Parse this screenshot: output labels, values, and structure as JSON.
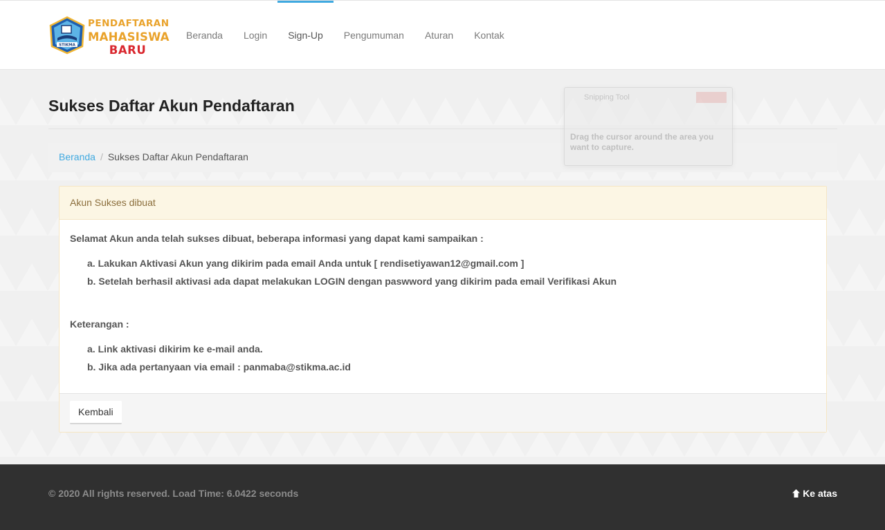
{
  "logo": {
    "line1": "PENDAFTARAN",
    "line2": "MAHASISWA",
    "line3": "BARU",
    "emblem_text": "STIKMA"
  },
  "nav": {
    "items": [
      {
        "label": "Beranda"
      },
      {
        "label": "Login"
      },
      {
        "label": "Sign-Up"
      },
      {
        "label": "Pengumuman"
      },
      {
        "label": "Aturan"
      },
      {
        "label": "Kontak"
      }
    ],
    "active": "Sign-Up"
  },
  "page": {
    "title": "Sukses Daftar Akun Pendaftaran"
  },
  "breadcrumb": {
    "home": "Beranda",
    "separator": "/",
    "current": "Sukses Daftar Akun Pendaftaran"
  },
  "panel": {
    "heading": "Akun Sukses dibuat",
    "intro": "Selamat Akun anda telah sukses dibuat, beberapa informasi yang dapat kami sampaikan :",
    "list1": [
      "a. Lakukan Aktivasi Akun yang dikirim pada email Anda untuk [ rendisetiyawan12@gmail.com ]",
      "b. Setelah berhasil aktivasi ada dapat melakukan LOGIN dengan paswword yang dikirim pada email Verifikasi Akun"
    ],
    "keterangan_label": "Keterangan :",
    "list2": [
      "a. Link aktivasi dikirim ke e-mail anda.",
      "b. Jika ada pertanyaan via email : panmaba@stikma.ac.id"
    ],
    "back_button": "Kembali"
  },
  "ghost_overlay": {
    "title": "Snipping Tool",
    "text": "Drag the cursor around the area you want to capture."
  },
  "footer": {
    "copyright": "© 2020 All rights reserved. Load Time: 6.0422 seconds",
    "to_top": "Ke atas"
  },
  "colors": {
    "accent": "#3fa9e0",
    "logo_orange": "#e9a22a",
    "logo_red": "#d9272e",
    "warning_heading_bg": "#fcf6e4",
    "footer_bg": "#303030"
  },
  "icons": {
    "to_top": "arrow-up-icon"
  }
}
